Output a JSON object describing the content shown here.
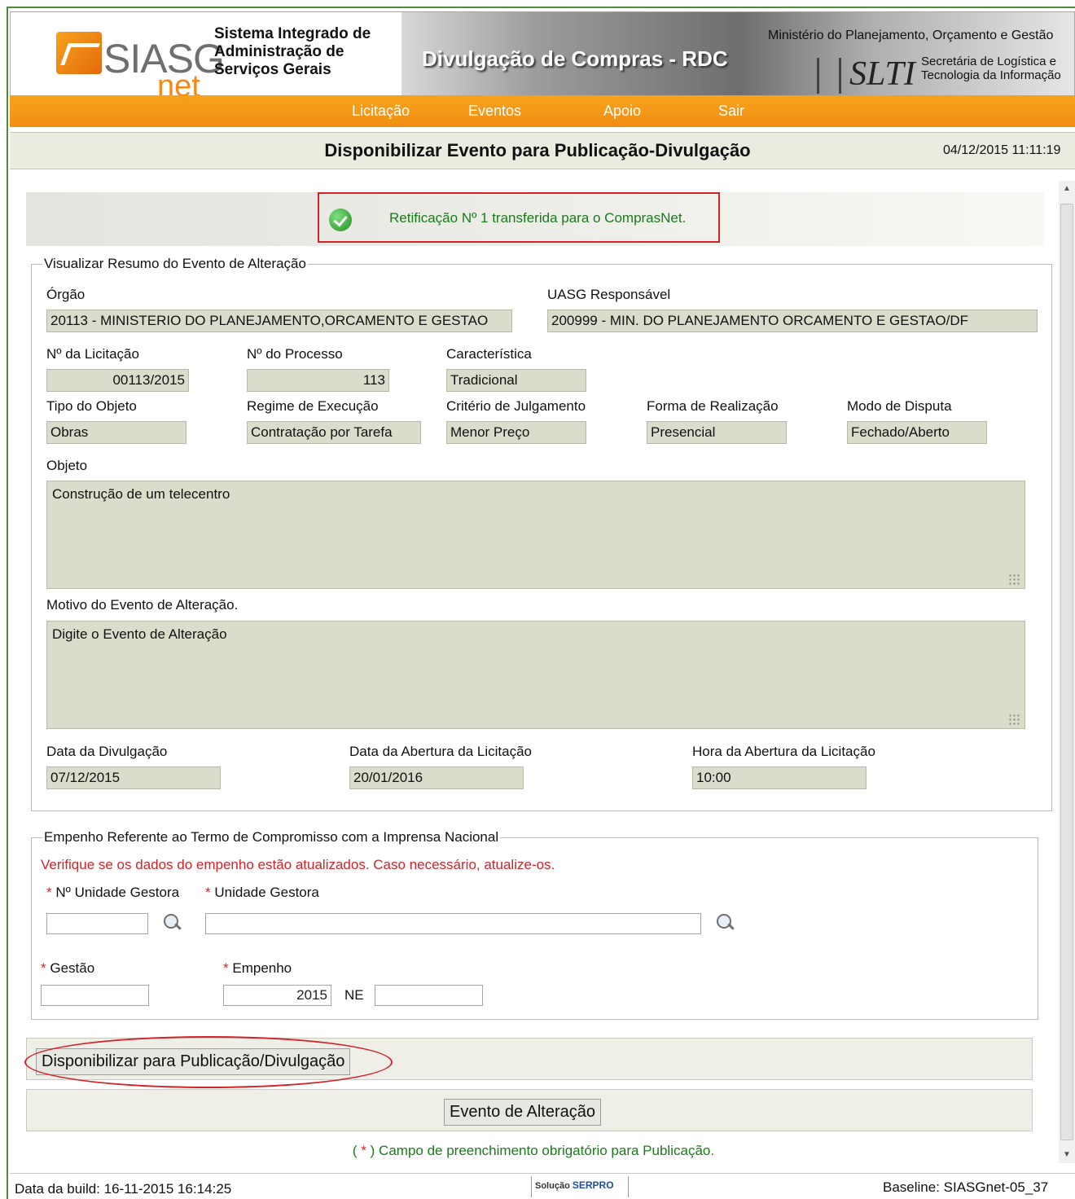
{
  "header": {
    "logo_siasg": "SIASG",
    "logo_net": "net",
    "system_name": "Sistema Integrado de Administração de Serviços Gerais",
    "banner_title": "Divulgação de Compras - RDC",
    "ministry": "Ministério do Planejamento, Orçamento e Gestão",
    "slti": "SLTI",
    "slti_name": "Secretária de Logística e Tecnologia da Informação"
  },
  "menu": {
    "items": [
      {
        "label": "Licitação"
      },
      {
        "label": "Eventos"
      },
      {
        "label": "Apoio"
      },
      {
        "label": "Sair"
      }
    ]
  },
  "page": {
    "title": "Disponibilizar Evento para Publicação-Divulgação",
    "timestamp": "04/12/2015 11:11:19"
  },
  "message": {
    "text": "Retificação Nº 1 transferida para o ComprasNet."
  },
  "summary": {
    "legend": "Visualizar Resumo do Evento de Alteração",
    "orgao_label": "Órgão",
    "orgao_value": "20113 - MINISTERIO DO PLANEJAMENTO,ORCAMENTO E GESTAO",
    "uasg_label": "UASG Responsável",
    "uasg_value": "200999 - MIN. DO PLANEJAMENTO ORCAMENTO E GESTAO/DF",
    "licitacao_label": "Nº da Licitação",
    "licitacao_value": "00113/2015",
    "processo_label": "Nº do Processo",
    "processo_value": "113",
    "caracteristica_label": "Característica",
    "caracteristica_value": "Tradicional",
    "tipo_label": "Tipo do Objeto",
    "tipo_value": "Obras",
    "regime_label": "Regime de Execução",
    "regime_value": "Contratação por Tarefa",
    "criterio_label": "Critério de Julgamento",
    "criterio_value": "Menor Preço",
    "forma_label": "Forma de Realização",
    "forma_value": "Presencial",
    "modo_label": "Modo de Disputa",
    "modo_value": "Fechado/Aberto",
    "objeto_label": "Objeto",
    "objeto_value": "Construção de um telecentro",
    "motivo_label": "Motivo do Evento de Alteração.",
    "motivo_value": "Digite o Evento de Alteração",
    "data_divulgacao_label": "Data da Divulgação",
    "data_divulgacao_value": "07/12/2015",
    "data_abertura_label": "Data da Abertura da Licitação",
    "data_abertura_value": "20/01/2016",
    "hora_abertura_label": "Hora da Abertura da Licitação",
    "hora_abertura_value": "10:00"
  },
  "empenho": {
    "legend": "Empenho Referente ao Termo de Compromisso com a Imprensa Nacional",
    "warning": "Verifique se os dados do empenho estão atualizados. Caso necessário, atualize-os.",
    "required_mark": "*",
    "ug_num_label": "Nº Unidade Gestora",
    "ug_label": "Unidade Gestora",
    "gestao_label": "Gestão",
    "empenho_label": "Empenho",
    "empenho_year": "2015",
    "ne_label": "NE"
  },
  "buttons": {
    "disponibilizar": "Disponibilizar para Publicação/Divulgação",
    "evento": "Evento de Alteração"
  },
  "footnote": {
    "prefix": "( ",
    "mark": "*",
    "text": " ) Campo de preenchimento obrigatório para Publicação."
  },
  "footer": {
    "build": "Data da build: 16-11-2015 16:14:25",
    "solucao": "Solução",
    "serpro": "SERPRO",
    "baseline": "Baseline: SIASGnet-05_37"
  }
}
